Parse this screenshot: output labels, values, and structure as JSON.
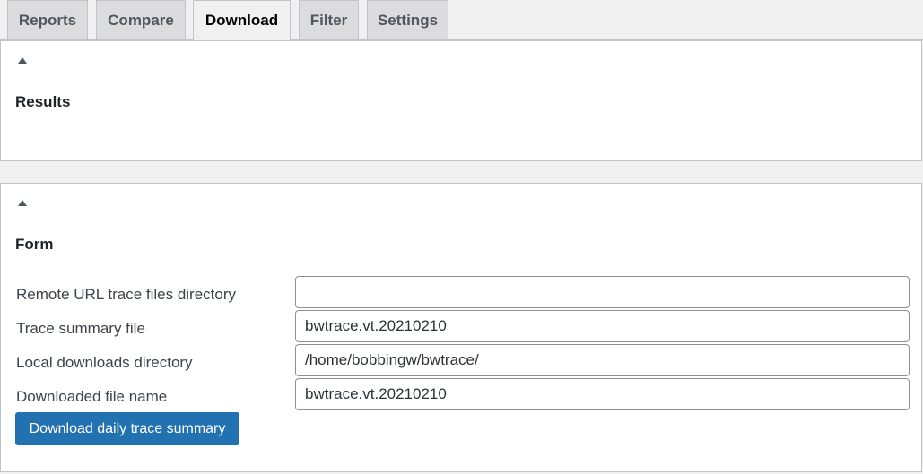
{
  "tabs": [
    {
      "label": "Reports",
      "active": false
    },
    {
      "label": "Compare",
      "active": false
    },
    {
      "label": "Download",
      "active": true
    },
    {
      "label": "Filter",
      "active": false
    },
    {
      "label": "Settings",
      "active": false
    }
  ],
  "results_panel": {
    "toggle_icon": "triangle-up-icon",
    "title": "Results"
  },
  "form_panel": {
    "toggle_icon": "triangle-up-icon",
    "title": "Form",
    "fields": [
      {
        "label": "Remote URL trace files directory",
        "value": ""
      },
      {
        "label": "Trace summary file",
        "value": "bwtrace.vt.20210210"
      },
      {
        "label": "Local downloads directory",
        "value": "/home/bobbingw/bwtrace/"
      },
      {
        "label": "Downloaded file name",
        "value": "bwtrace.vt.20210210"
      }
    ],
    "submit_label": "Download daily trace summary"
  },
  "colors": {
    "page_background": "#f0f0f1",
    "panel_background": "#ffffff",
    "tab_inactive": "#dcdcde",
    "primary_button": "#2271b1"
  }
}
